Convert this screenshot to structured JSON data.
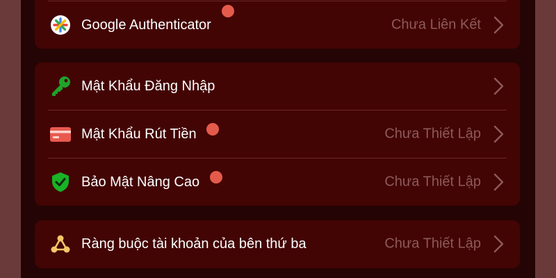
{
  "cards": [
    {
      "items": [
        {
          "label": "Google Authenticator",
          "status": "Chưa Liên Kết",
          "icon": "google-authenticator-icon",
          "badge": true
        }
      ]
    },
    {
      "items": [
        {
          "label": "Mật Khẩu Đăng Nhập",
          "status": "",
          "icon": "key-icon",
          "badge": false
        },
        {
          "label": "Mật Khẩu Rút Tiền",
          "status": "Chưa Thiết Lập",
          "icon": "card-icon",
          "badge": true
        },
        {
          "label": "Bảo Mật Nâng Cao",
          "status": "Chưa Thiết Lập",
          "icon": "shield-check-icon",
          "badge": true
        }
      ]
    },
    {
      "items": [
        {
          "label": "Ràng buộc tài khoản của bên thứ ba",
          "status": "Chưa Thiết Lập",
          "icon": "third-party-link-icon",
          "badge": false
        }
      ]
    }
  ],
  "colors": {
    "badge": "#e45b4b",
    "key": "#1fa32a",
    "card": "#e85a4f",
    "shield": "#19b325",
    "third_party": "#f5c66a"
  }
}
